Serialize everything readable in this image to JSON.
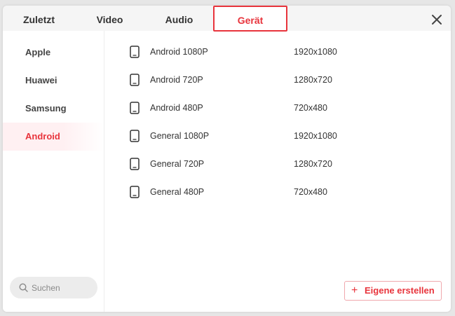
{
  "tabs": [
    {
      "label": "Zuletzt"
    },
    {
      "label": "Video"
    },
    {
      "label": "Audio"
    },
    {
      "label": "Gerät"
    }
  ],
  "active_tab": "Gerät",
  "sidebar": {
    "items": [
      {
        "label": "Apple"
      },
      {
        "label": "Huawei"
      },
      {
        "label": "Samsung"
      },
      {
        "label": "Android"
      }
    ],
    "active_item": "Android"
  },
  "search": {
    "placeholder": "Suchen"
  },
  "presets": [
    {
      "icon": "phone-icon",
      "name": "Android 1080P",
      "resolution": "1920x1080"
    },
    {
      "icon": "phone-icon",
      "name": "Android 720P",
      "resolution": "1280x720"
    },
    {
      "icon": "phone-icon",
      "name": "Android 480P",
      "resolution": "720x480"
    },
    {
      "icon": "phone-icon",
      "name": "General 1080P",
      "resolution": "1920x1080"
    },
    {
      "icon": "phone-icon",
      "name": "General 720P",
      "resolution": "1280x720"
    },
    {
      "icon": "phone-icon",
      "name": "General 480P",
      "resolution": "720x480"
    }
  ],
  "create_button": {
    "label": "Eigene erstellen"
  },
  "colors": {
    "accent": "#e8343c",
    "active_bg": "#fff0f2"
  }
}
